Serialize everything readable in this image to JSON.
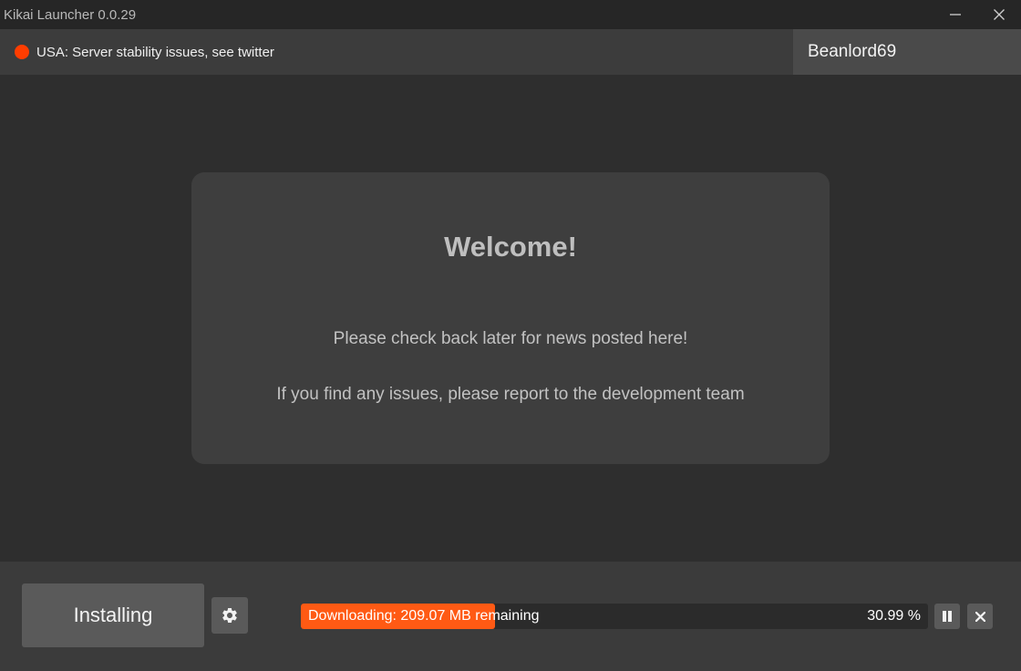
{
  "window": {
    "title": "Kikai Launcher 0.0.29",
    "minimize_icon": "minimize-icon",
    "close_icon": "close-icon"
  },
  "status": {
    "message": "USA: Server stability issues, see twitter",
    "indicator_color": "#ff3d00"
  },
  "user": {
    "name": "Beanlord69"
  },
  "news": {
    "title": "Welcome!",
    "lines": [
      "Please check back later for news posted here!",
      "If you find any issues, please report to the development team"
    ]
  },
  "footer": {
    "install_button_label": "Installing",
    "settings_icon": "gear-icon",
    "progress": {
      "label": "Downloading: 209.07 MB remaining",
      "percent_text": "30.99 %",
      "fraction": 0.3099,
      "fill_color": "#ff5a14"
    },
    "pause_icon": "pause-icon",
    "cancel_icon": "close-icon"
  }
}
